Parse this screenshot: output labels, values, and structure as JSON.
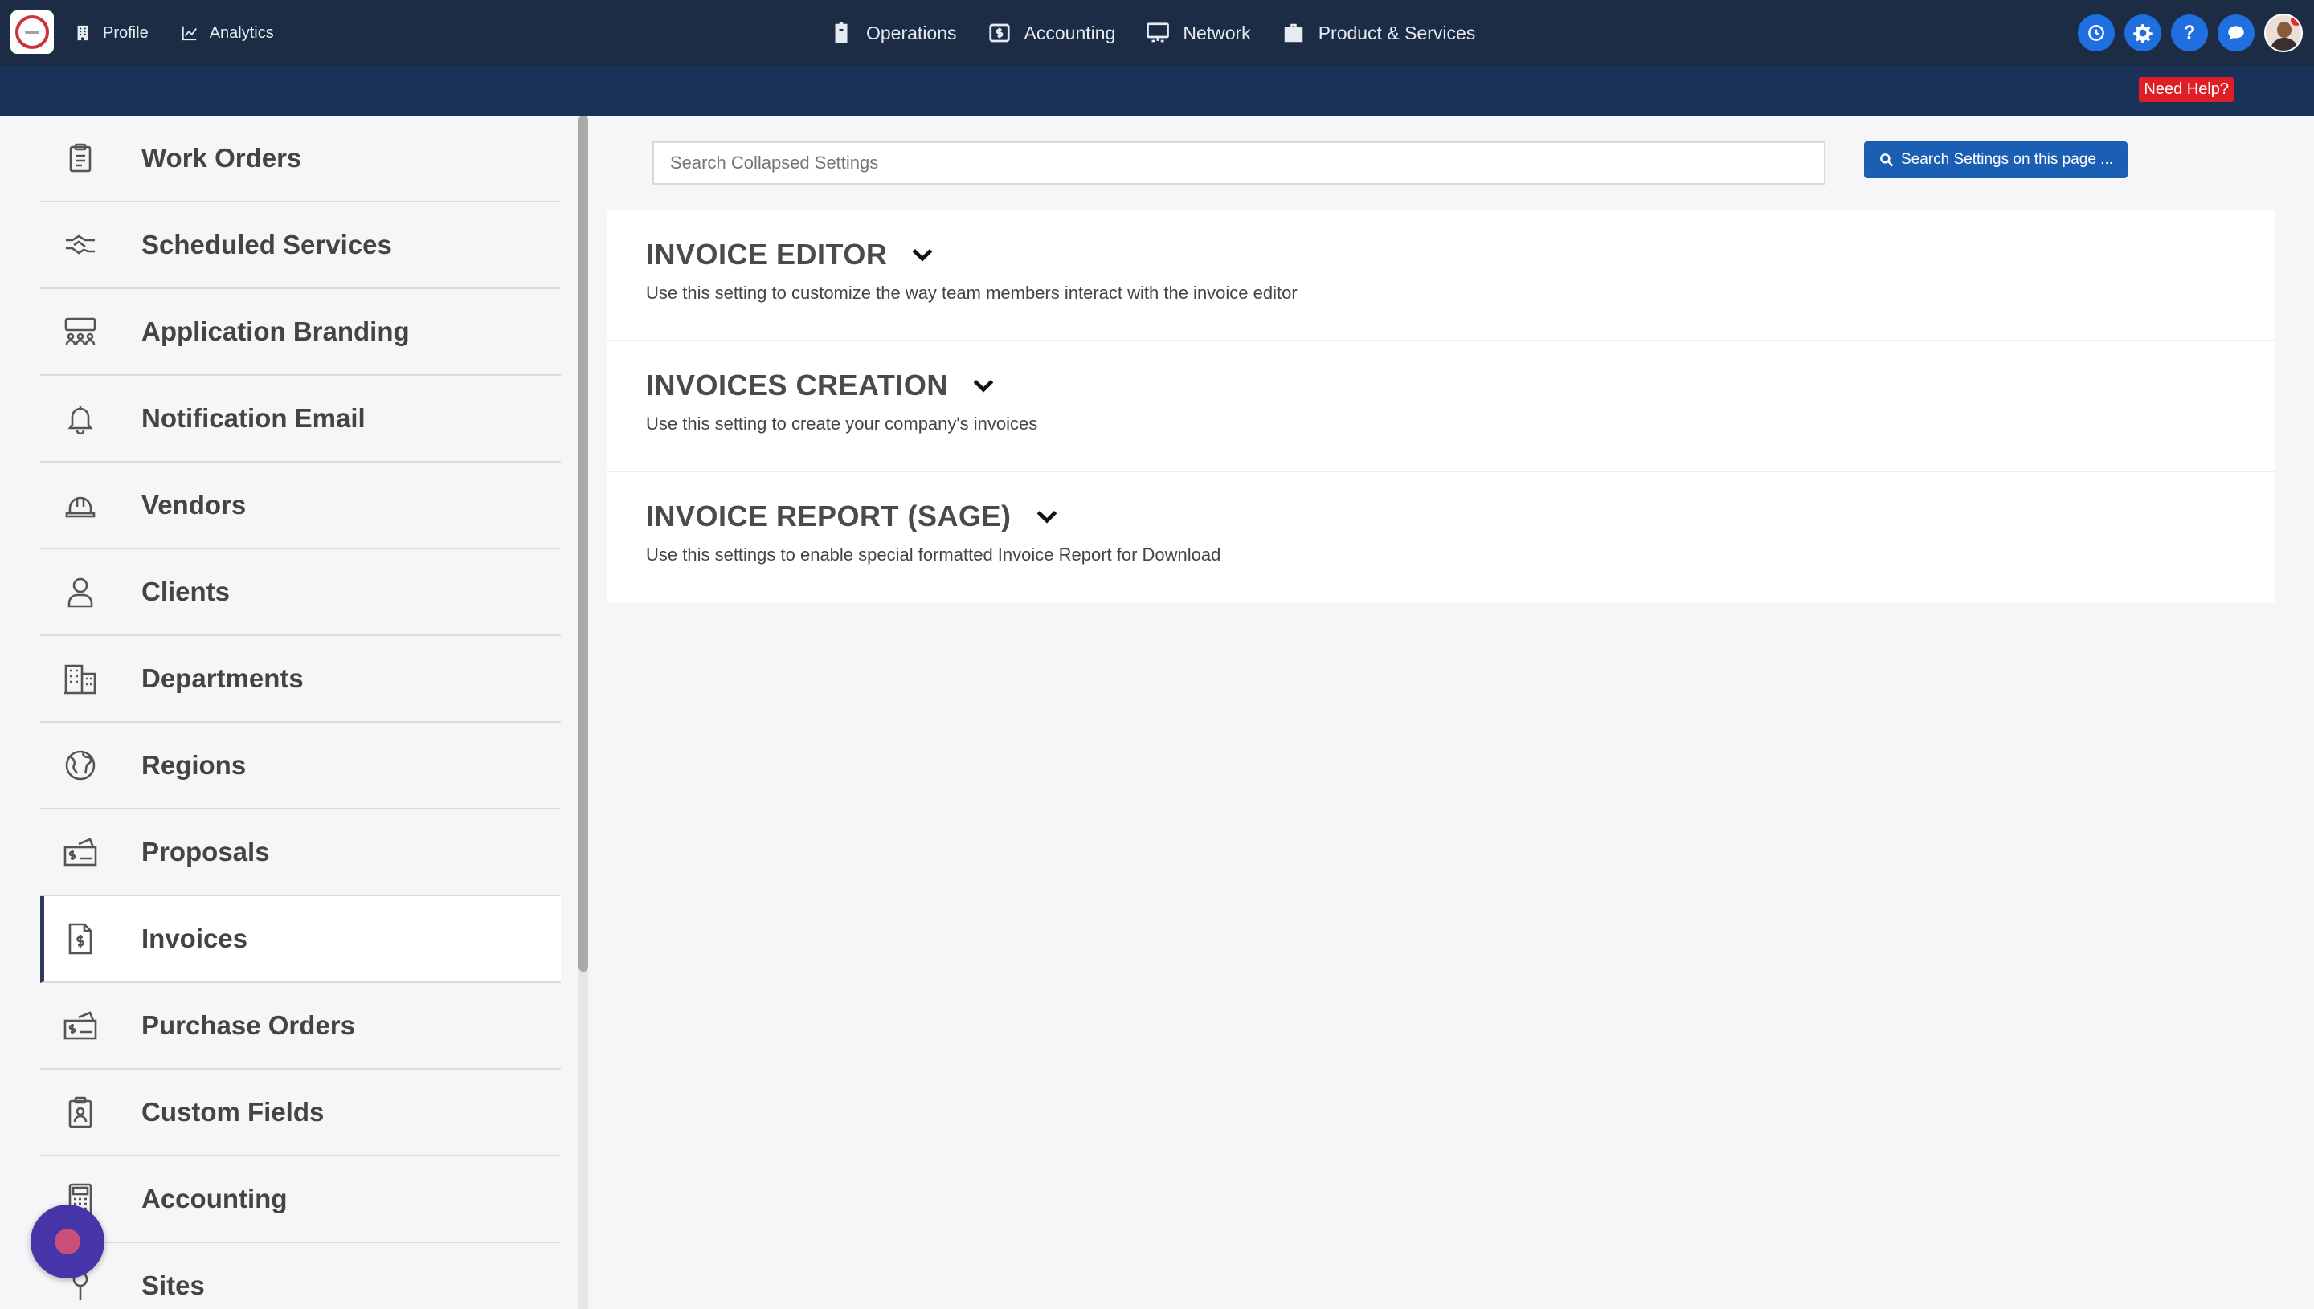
{
  "topnav": {
    "left": [
      {
        "label": "Profile",
        "icon": "building-icon"
      },
      {
        "label": "Analytics",
        "icon": "chart-line-icon"
      }
    ],
    "center": [
      {
        "label": "Operations",
        "icon": "clipboard-icon"
      },
      {
        "label": "Accounting",
        "icon": "money-box-icon"
      },
      {
        "label": "Network",
        "icon": "network-icon"
      },
      {
        "label": "Product & Services",
        "icon": "briefcase-icon"
      }
    ],
    "right": {
      "help_glyph": "?"
    }
  },
  "subbar": {
    "need_help": "Need Help?"
  },
  "sidebar": {
    "items": [
      {
        "label": "Work Orders",
        "icon": "clipboard-list-icon"
      },
      {
        "label": "Scheduled Services",
        "icon": "handshake-icon"
      },
      {
        "label": "Application Branding",
        "icon": "users-group-icon"
      },
      {
        "label": "Notification Email",
        "icon": "bell-icon"
      },
      {
        "label": "Vendors",
        "icon": "hard-hat-icon"
      },
      {
        "label": "Clients",
        "icon": "user-icon"
      },
      {
        "label": "Departments",
        "icon": "building-icon"
      },
      {
        "label": "Regions",
        "icon": "globe-icon"
      },
      {
        "label": "Proposals",
        "icon": "money-sign-icon"
      },
      {
        "label": "Invoices",
        "icon": "invoice-icon",
        "active": true
      },
      {
        "label": "Purchase Orders",
        "icon": "money-sign-icon"
      },
      {
        "label": "Custom Fields",
        "icon": "clipboard-user-icon"
      },
      {
        "label": "Accounting",
        "icon": "calculator-icon"
      },
      {
        "label": "Sites",
        "icon": "map-pin-icon"
      }
    ]
  },
  "main": {
    "search_placeholder": "Search Collapsed Settings",
    "search_button": "Search Settings on this page ...",
    "sections": [
      {
        "title": "INVOICE EDITOR",
        "description": "Use this setting to customize the way team members interact with the invoice editor"
      },
      {
        "title": "INVOICES CREATION",
        "description": "Use this setting to create your company's invoices"
      },
      {
        "title": "INVOICE REPORT (SAGE)",
        "description": "Use this settings to enable special formatted Invoice Report for Download"
      }
    ]
  },
  "colors": {
    "nav_bg": "#1d2c45",
    "subbar_bg": "#1b3258",
    "accent_blue": "#1a5fb4",
    "need_help_red": "#e01e25"
  }
}
